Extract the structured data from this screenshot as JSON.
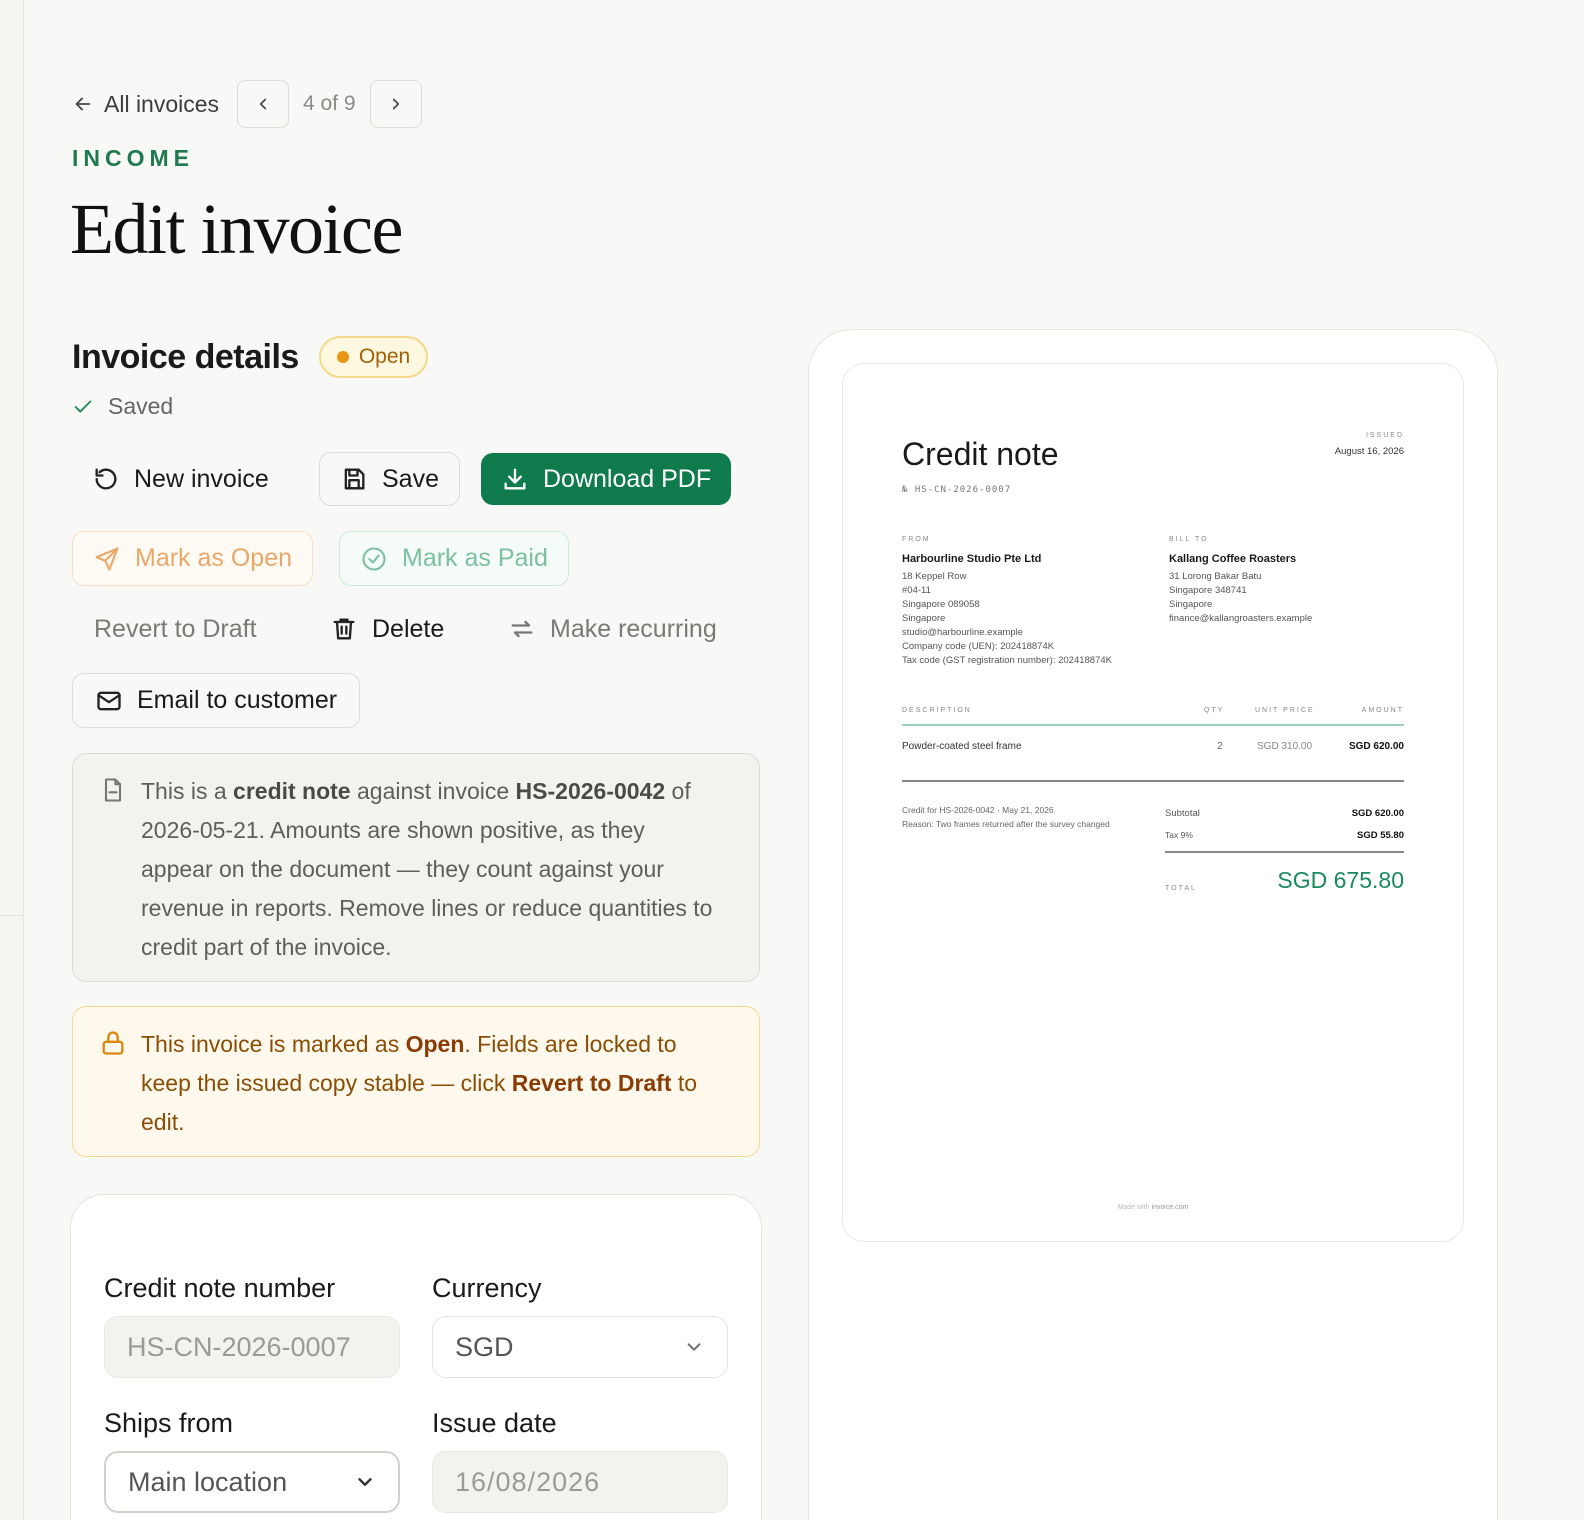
{
  "nav": {
    "back_label": "All invoices",
    "pager": "4 of 9"
  },
  "header": {
    "eyebrow": "INCOME",
    "title": "Edit invoice"
  },
  "details": {
    "title": "Invoice details",
    "status": "Open",
    "saved": "Saved"
  },
  "actions": {
    "new_invoice": "New invoice",
    "save": "Save",
    "download_pdf": "Download PDF",
    "mark_open": "Mark as Open",
    "mark_paid": "Mark as Paid",
    "revert": "Revert to Draft",
    "delete": "Delete",
    "recurring": "Make recurring",
    "email": "Email to customer"
  },
  "credit_notice": {
    "p1": "This is a ",
    "b1": "credit note",
    "p2": " against invoice ",
    "b2": "HS-2026-0042",
    "p3": " of 2026-05-21. Amounts are shown positive, as they appear on the document — they count against your revenue in reports. Remove lines or reduce quantities to credit part of the invoice."
  },
  "lock_notice": {
    "p1": "This invoice is marked as ",
    "b1": "Open",
    "p2": ". Fields are locked to keep the issued copy stable — click ",
    "b2": "Revert to Draft",
    "p3": " to edit."
  },
  "form": {
    "number_label": "Credit note number",
    "number_value": "HS-CN-2026-0007",
    "currency_label": "Currency",
    "currency_value": "SGD",
    "ships_label": "Ships from",
    "ships_value": "Main location",
    "date_label": "Issue date",
    "date_value": "16/08/2026"
  },
  "preview": {
    "title": "Credit note",
    "number": "№ HS-CN-2026-0007",
    "issued_label": "ISSUED",
    "issued_date": "August 16, 2026",
    "from_label": "FROM",
    "from": {
      "name": "Harbourline Studio Pte Ltd",
      "lines": [
        "18 Keppel Row",
        "#04-11",
        "Singapore 089058",
        "Singapore",
        "studio@harbourline.example",
        "Company code (UEN): 202418874K",
        "Tax code (GST registration number): 202418874K"
      ]
    },
    "bill_label": "BILL TO",
    "bill": {
      "name": "Kallang Coffee Roasters",
      "lines": [
        "31 Lorong Bakar Batu",
        "Singapore 348741",
        "Singapore",
        "finance@kallangroasters.example"
      ]
    },
    "columns": {
      "description": "DESCRIPTION",
      "qty": "QTY",
      "unit_price": "UNIT PRICE",
      "amount": "AMOUNT"
    },
    "items": [
      {
        "description": "Powder-coated steel frame",
        "qty": "2",
        "unit_price": "SGD 310.00",
        "amount": "SGD 620.00"
      }
    ],
    "note_line1": "Credit for HS-2026-0042 · May 21, 2026",
    "note_line2": "Reason: Two frames returned after the survey changed",
    "subtotal_label": "Subtotal",
    "subtotal": "SGD 620.00",
    "tax_label": "Tax 9%",
    "tax": "SGD 55.80",
    "total_label": "TOTAL",
    "total": "SGD 675.80",
    "footer_prefix": "Made with ",
    "footer_brand": "invoice.com"
  }
}
